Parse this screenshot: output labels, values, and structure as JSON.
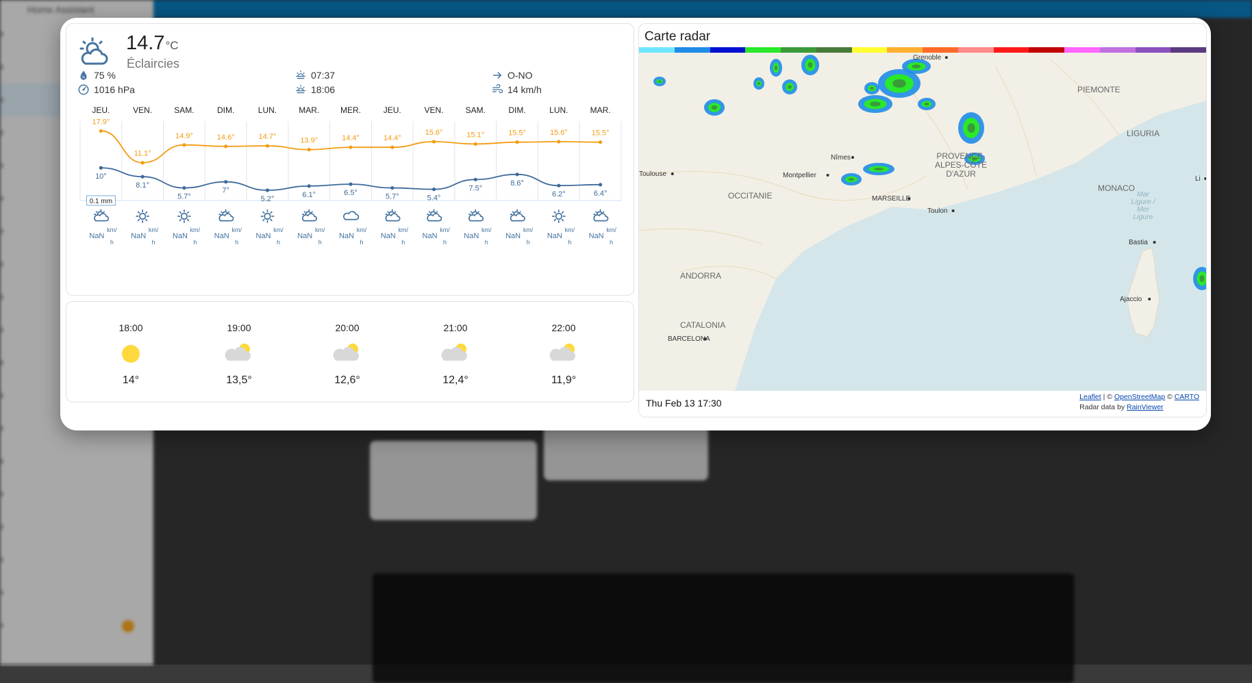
{
  "background": {
    "sidebar_title": "Home Assistant",
    "sidebar_items": [
      "",
      "",
      "",
      "",
      "",
      "",
      "",
      "",
      "",
      "",
      "",
      "",
      "",
      "",
      "",
      "",
      "",
      "",
      ""
    ],
    "tiles": [
      "",
      "",
      ""
    ]
  },
  "current": {
    "temperature": "14.7",
    "unit": "°C",
    "condition": "Éclaircies",
    "humidity": "75 %",
    "pressure": "1016 hPa",
    "sunrise": "07:37",
    "sunset": "18:06",
    "wind_direction": "O-NO",
    "wind_speed": "14 km/h"
  },
  "forecast_days": [
    {
      "day": "JEU.",
      "high": "17.9°",
      "low": "10°",
      "icon": "partly-cloudy-day-icon",
      "wind": "NaN",
      "wind_unit": "km/h"
    },
    {
      "day": "VEN.",
      "high": "11.1°",
      "low": "8.1°",
      "icon": "sunny-icon",
      "wind": "NaN",
      "wind_unit": "km/h"
    },
    {
      "day": "SAM.",
      "high": "14.9°",
      "low": "5.7°",
      "icon": "sunny-icon",
      "wind": "NaN",
      "wind_unit": "km/h"
    },
    {
      "day": "DIM.",
      "high": "14.6°",
      "low": "7°",
      "icon": "partly-cloudy-day-icon",
      "wind": "NaN",
      "wind_unit": "km/h"
    },
    {
      "day": "LUN.",
      "high": "14.7°",
      "low": "5.2°",
      "icon": "sunny-icon",
      "wind": "NaN",
      "wind_unit": "km/h"
    },
    {
      "day": "MAR.",
      "high": "13.9°",
      "low": "6.1°",
      "icon": "partly-cloudy-day-icon",
      "wind": "NaN",
      "wind_unit": "km/h"
    },
    {
      "day": "MER.",
      "high": "14.4°",
      "low": "6.5°",
      "icon": "cloudy-icon",
      "wind": "NaN",
      "wind_unit": "km/h"
    },
    {
      "day": "JEU.",
      "high": "14.4°",
      "low": "5.7°",
      "icon": "partly-cloudy-day-icon",
      "wind": "NaN",
      "wind_unit": "km/h"
    },
    {
      "day": "VEN.",
      "high": "15.6°",
      "low": "5.4°",
      "icon": "partly-cloudy-day-icon",
      "wind": "NaN",
      "wind_unit": "km/h"
    },
    {
      "day": "SAM.",
      "high": "15.1°",
      "low": "7.5°",
      "icon": "partly-cloudy-day-icon",
      "wind": "NaN",
      "wind_unit": "km/h"
    },
    {
      "day": "DIM.",
      "high": "15.5°",
      "low": "8.6°",
      "icon": "partly-cloudy-day-icon",
      "wind": "NaN",
      "wind_unit": "km/h"
    },
    {
      "day": "LUN.",
      "high": "15.6°",
      "low": "6.2°",
      "icon": "sunny-icon",
      "wind": "NaN",
      "wind_unit": "km/h"
    },
    {
      "day": "MAR.",
      "high": "15.5°",
      "low": "6.4°",
      "icon": "partly-cloudy-day-icon",
      "wind": "NaN",
      "wind_unit": "km/h"
    }
  ],
  "chart_data": {
    "type": "line",
    "categories": [
      "JEU.",
      "VEN.",
      "SAM.",
      "DIM.",
      "LUN.",
      "MAR.",
      "MER.",
      "JEU.",
      "VEN.",
      "SAM.",
      "DIM.",
      "LUN.",
      "MAR."
    ],
    "series": [
      {
        "values": [
          17.9,
          11.1,
          14.9,
          14.6,
          14.7,
          13.9,
          14.4,
          14.4,
          15.6,
          15.1,
          15.5,
          15.6,
          15.5
        ],
        "color": "#f39c12"
      },
      {
        "values": [
          10,
          8.1,
          5.7,
          7,
          5.2,
          6.1,
          6.5,
          5.7,
          5.4,
          7.5,
          8.6,
          6.2,
          6.4
        ],
        "color": "#3d6a99"
      }
    ],
    "precipitation": [
      {
        "index": 0,
        "label": "0.1 mm",
        "value": 0.1
      }
    ],
    "ylim": [
      3,
      20
    ]
  },
  "hourly": [
    {
      "time": "18:00",
      "temp": "14°",
      "icon": "sunny-icon"
    },
    {
      "time": "19:00",
      "temp": "13,5°",
      "icon": "partly-cloudy-night-icon"
    },
    {
      "time": "20:00",
      "temp": "12,6°",
      "icon": "partly-cloudy-night-icon"
    },
    {
      "time": "21:00",
      "temp": "12,4°",
      "icon": "partly-cloudy-night-icon"
    },
    {
      "time": "22:00",
      "temp": "11,9°",
      "icon": "partly-cloudy-night-icon"
    }
  ],
  "radar": {
    "title": "Carte radar",
    "timestamp": "Thu Feb 13 17:30",
    "attribution": {
      "leaflet": "Leaflet",
      "sep1": " | © ",
      "osm": "OpenStreetMap",
      "sep2": " © ",
      "carto": "CARTO",
      "radar_prefix": "Radar data by ",
      "rainviewer": "RainViewer"
    },
    "legend_colors": [
      "#6ee6ff",
      "#1e8ce6",
      "#0010d0",
      "#2ae82a",
      "#3a9a3a",
      "#4a7a3a",
      "#ffff32",
      "#ffb030",
      "#ff6a2a",
      "#ff8a8a",
      "#ff1a1a",
      "#c00000",
      "#ff66ff",
      "#c070e0",
      "#8a50c0",
      "#5a3a80"
    ],
    "labels": {
      "regions": [
        "OCCITANIE",
        "PROVENCE-ALPES-CÔTE D'AZUR",
        "PIEMONTE",
        "LIGURIA",
        "MONACO",
        "ANDORRA",
        "CATALONIA",
        "Mar Ligure / Mer Ligure"
      ],
      "cities": [
        "Grenoble",
        "Toulouse",
        "Montpellier",
        "Nîmes",
        "MARSEILLE",
        "Toulon",
        "Bastia",
        "Ajaccio",
        "BARCELONA",
        "Li"
      ]
    },
    "accent": "#0a78b8"
  }
}
